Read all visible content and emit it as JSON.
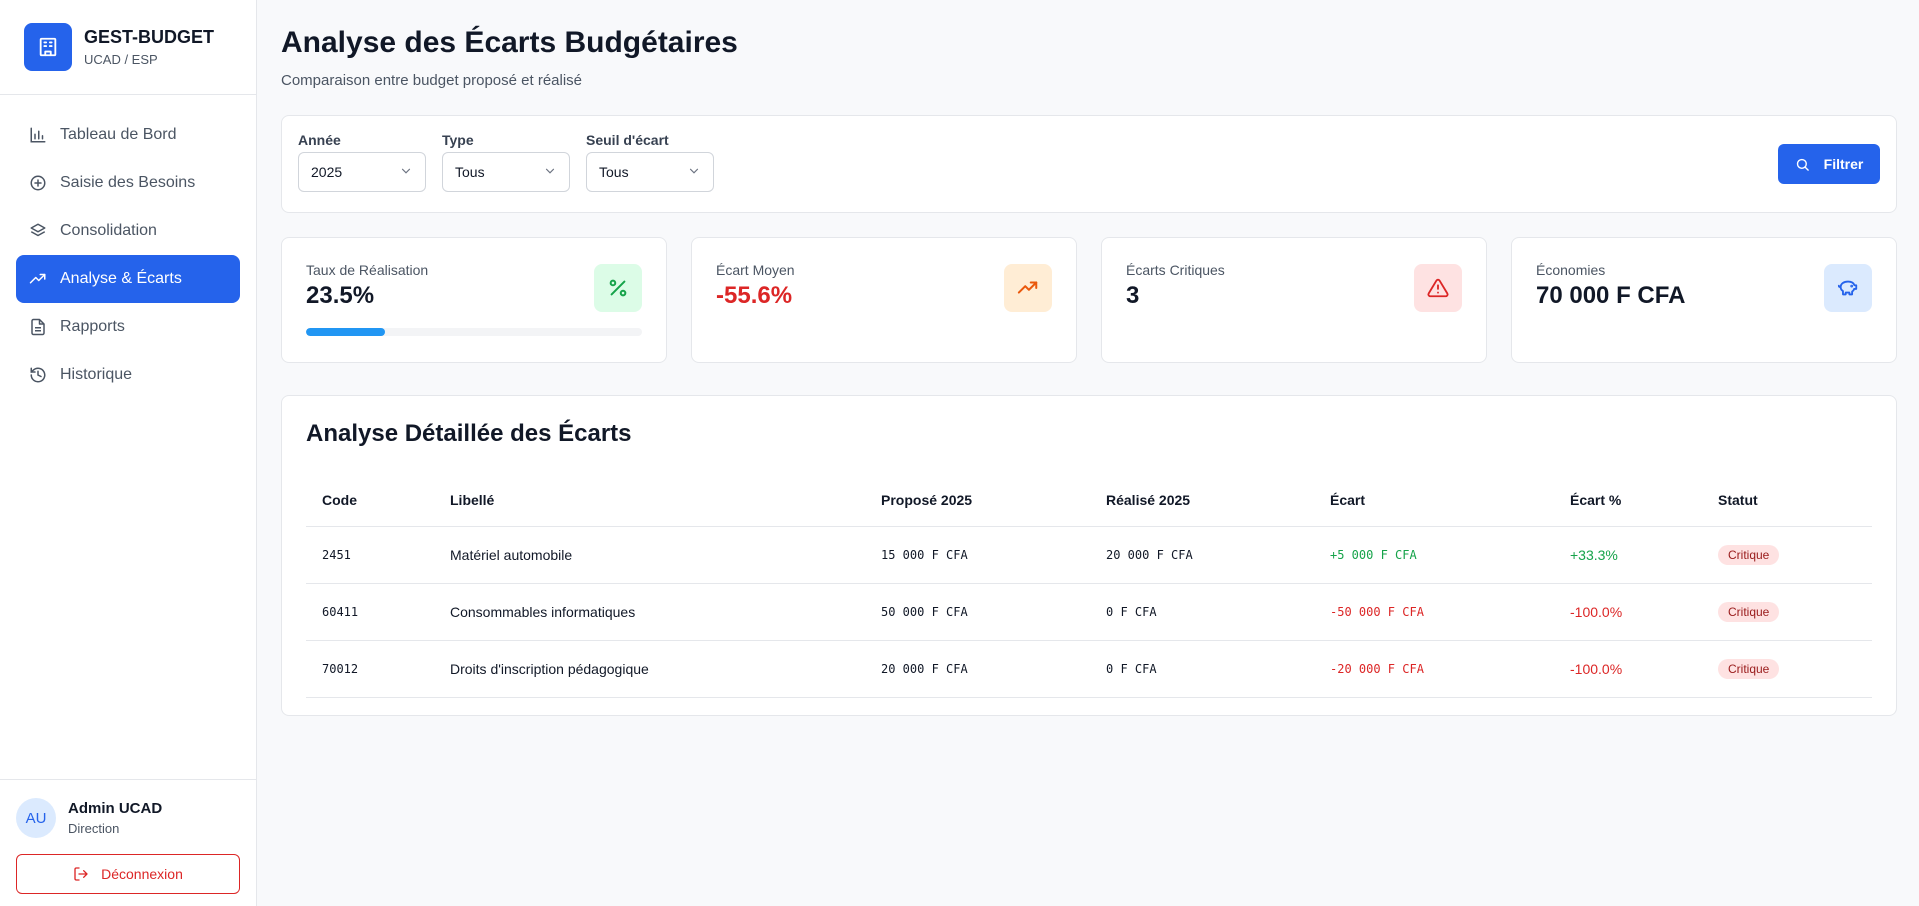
{
  "brand": {
    "name": "GEST-BUDGET",
    "subtitle": "UCAD / ESP",
    "logo_icon": "building-icon"
  },
  "nav": [
    {
      "label": "Tableau de Bord",
      "icon": "bar-chart-icon",
      "active": false
    },
    {
      "label": "Saisie des Besoins",
      "icon": "plus-circle-icon",
      "active": false
    },
    {
      "label": "Consolidation",
      "icon": "layers-icon",
      "active": false
    },
    {
      "label": "Analyse & Écarts",
      "icon": "trending-up-icon",
      "active": true
    },
    {
      "label": "Rapports",
      "icon": "file-text-icon",
      "active": false
    },
    {
      "label": "Historique",
      "icon": "history-icon",
      "active": false
    }
  ],
  "user": {
    "initials": "AU",
    "name": "Admin UCAD",
    "role": "Direction",
    "logout_label": "Déconnexion"
  },
  "page": {
    "title": "Analyse des Écarts Budgétaires",
    "subtitle": "Comparaison entre budget proposé et réalisé"
  },
  "filters": {
    "year": {
      "label": "Année",
      "value": "2025"
    },
    "type": {
      "label": "Type",
      "value": "Tous"
    },
    "threshold": {
      "label": "Seuil d'écart",
      "value": "Tous"
    },
    "button_label": "Filtrer"
  },
  "kpis": {
    "realisation": {
      "label": "Taux de Réalisation",
      "value": "23.5%",
      "progress": 0.235,
      "icon": "percent-icon",
      "color": "#16a34a"
    },
    "ecart_moyen": {
      "label": "Écart Moyen",
      "value": "-55.6%",
      "icon": "trending-up-icon",
      "color": "#ea580c"
    },
    "critiques": {
      "label": "Écarts Critiques",
      "value": "3",
      "icon": "alert-triangle-icon",
      "color": "#dc2626"
    },
    "economies": {
      "label": "Économies",
      "value": "70 000 F CFA",
      "icon": "piggy-bank-icon",
      "color": "#2563eb"
    }
  },
  "table": {
    "title": "Analyse Détaillée des Écarts",
    "headers": [
      "Code",
      "Libellé",
      "Proposé 2025",
      "Réalisé 2025",
      "Écart",
      "Écart %",
      "Statut"
    ],
    "rows": [
      {
        "code": "2451",
        "libelle": "Matériel automobile",
        "propose": "15 000 F CFA",
        "realise": "20 000 F CFA",
        "ecart": "+5 000 F CFA",
        "ecart_pct": "+33.3%",
        "statut": "Critique",
        "sign": "pos"
      },
      {
        "code": "60411",
        "libelle": "Consommables informatiques",
        "propose": "50 000 F CFA",
        "realise": "0 F CFA",
        "ecart": "-50 000 F CFA",
        "ecart_pct": "-100.0%",
        "statut": "Critique",
        "sign": "neg"
      },
      {
        "code": "70012",
        "libelle": "Droits d'inscription pédagogique",
        "propose": "20 000 F CFA",
        "realise": "0 F CFA",
        "ecart": "-20 000 F CFA",
        "ecart_pct": "-100.0%",
        "statut": "Critique",
        "sign": "neg"
      }
    ]
  }
}
